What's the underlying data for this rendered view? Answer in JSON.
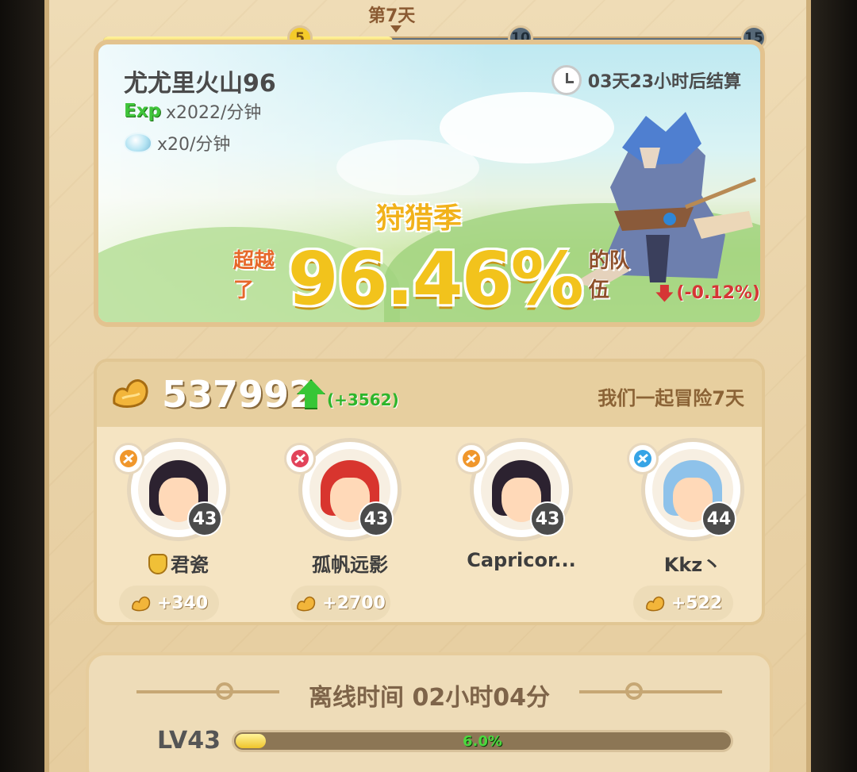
{
  "day_progress": {
    "day_label": "第7天",
    "nodes": [
      "5",
      "10",
      "15"
    ],
    "fill_fraction": 0.44
  },
  "hero": {
    "title": "尤尤里火山96",
    "exp_tag": "Exp",
    "exp_rate": "x2022/分钟",
    "crystal_rate": "x20/分钟",
    "timer": "03天23小时后结算",
    "season": "狩猎季",
    "surpass_pre": "超越了",
    "percent": "96.46%",
    "surpass_post": "的队伍",
    "delta": "(-0.12%)"
  },
  "team": {
    "score": "537992",
    "score_delta": "(+3562)",
    "days_text": "我们一起冒险7天",
    "members": [
      {
        "name": "君瓷",
        "level": "43",
        "bonus": "+340",
        "class_icon": "bow-class-icon",
        "badge_color": "#f0972c",
        "hair": "#2c2230",
        "has_guild": true
      },
      {
        "name": "孤帆远影",
        "level": "43",
        "bonus": "+2700",
        "class_icon": "warrior-class-icon",
        "badge_color": "#e2435a",
        "hair": "#d8352e",
        "has_guild": false
      },
      {
        "name": "Capricor...",
        "level": "43",
        "bonus": "",
        "class_icon": "fire-class-icon",
        "badge_color": "#f0972c",
        "hair": "#2c2230",
        "has_guild": false
      },
      {
        "name": "Kkz丶",
        "level": "44",
        "bonus": "+522",
        "class_icon": "water-class-icon",
        "badge_color": "#36a4e6",
        "hair": "#8ec2ea",
        "has_guild": false
      }
    ]
  },
  "offline": {
    "title": "离线时间 02小时04分",
    "level": "LV43",
    "xp_text": "6.0%",
    "xp_fraction": 0.06
  }
}
